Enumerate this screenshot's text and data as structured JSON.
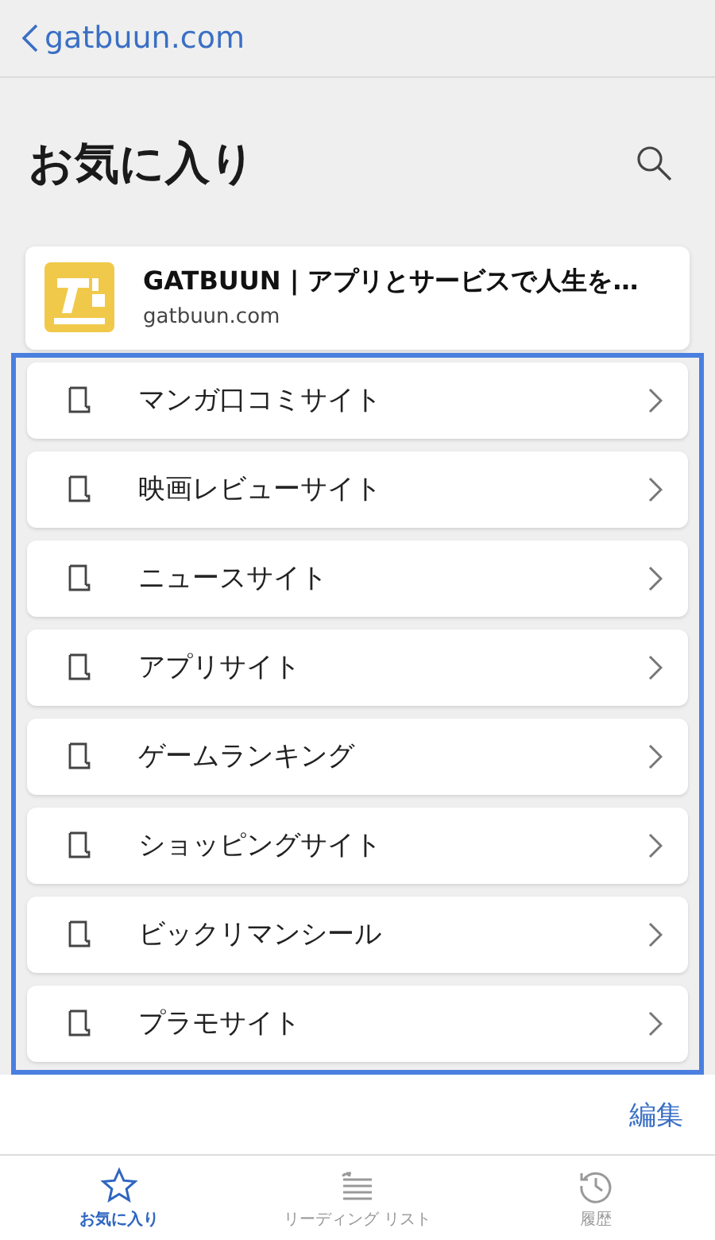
{
  "nav": {
    "back_label": "gatbuun.com"
  },
  "title": "お気に入り",
  "site_card": {
    "title": "GATBUUN | アプリとサービスで人生を…",
    "url": "gatbuun.com"
  },
  "folders": [
    {
      "name": "マンガ口コミサイト"
    },
    {
      "name": "映画レビューサイト"
    },
    {
      "name": "ニュースサイト"
    },
    {
      "name": "アプリサイト"
    },
    {
      "name": "ゲームランキング"
    },
    {
      "name": "ショッピングサイト"
    },
    {
      "name": "ビックリマンシール"
    },
    {
      "name": "プラモサイト"
    }
  ],
  "edit_label": "編集",
  "tabs": [
    {
      "label": "お気に入り",
      "kind": "star",
      "selected": true
    },
    {
      "label": "リーディング リスト",
      "kind": "list",
      "selected": false
    },
    {
      "label": "履歴",
      "kind": "history",
      "selected": false
    }
  ]
}
